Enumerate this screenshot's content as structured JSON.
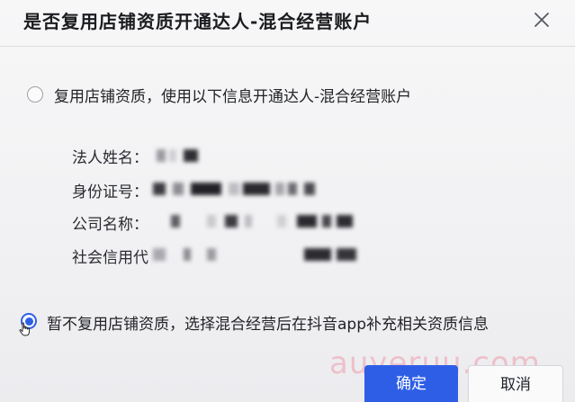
{
  "dialog": {
    "title": "是否复用店铺资质开通达人-混合经营账户",
    "close_icon": "close-icon"
  },
  "options": {
    "reuse": {
      "label": "复用店铺资质，使用以下信息开通达人-混合经营账户",
      "selected": false
    },
    "no_reuse": {
      "label": "暂不复用店铺资质，选择混合经营后在抖音app补充相关资质信息",
      "selected": true
    }
  },
  "fields": {
    "legal_name_label": "法人姓名：",
    "id_number_label": "身份证号：",
    "company_name_label": "公司名称：",
    "credit_code_label": "社会信用代"
  },
  "buttons": {
    "confirm_label": "确定",
    "cancel_label": "取消"
  },
  "watermark": {
    "text": "auyeruu.com"
  },
  "colors": {
    "primary": "#2f5ee6",
    "background": "#f3f3f5"
  }
}
